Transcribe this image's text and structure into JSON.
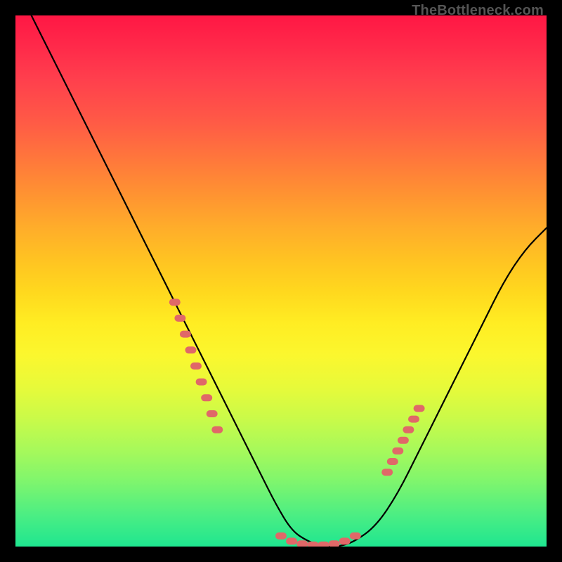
{
  "attribution": "TheBottleneck.com",
  "colors": {
    "frame": "#000000",
    "curve": "#000000",
    "marker": "#e06868",
    "gradient_top": "#ff1744",
    "gradient_bottom": "#1fe690"
  },
  "chart_data": {
    "type": "line",
    "title": "",
    "xlabel": "",
    "ylabel": "",
    "xlim": [
      0,
      100
    ],
    "ylim": [
      0,
      100
    ],
    "grid": false,
    "legend": false,
    "series": [
      {
        "name": "bottleneck-curve",
        "x": [
          3,
          6,
          10,
          14,
          18,
          22,
          26,
          30,
          34,
          38,
          42,
          46,
          49,
          52,
          55,
          58,
          61,
          64,
          68,
          72,
          76,
          80,
          84,
          88,
          92,
          96,
          100
        ],
        "y": [
          100,
          94,
          86,
          78,
          70,
          62,
          54,
          46,
          38,
          30,
          22,
          14,
          8,
          3,
          1,
          0,
          0,
          1,
          4,
          10,
          18,
          26,
          34,
          42,
          50,
          56,
          60
        ]
      }
    ],
    "markers": {
      "note": "highlighted points along the curve (salmon segments)",
      "points": [
        {
          "x": 30,
          "y": 46
        },
        {
          "x": 31,
          "y": 43
        },
        {
          "x": 32,
          "y": 40
        },
        {
          "x": 33,
          "y": 37
        },
        {
          "x": 34,
          "y": 34
        },
        {
          "x": 35,
          "y": 31
        },
        {
          "x": 36,
          "y": 28
        },
        {
          "x": 37,
          "y": 25
        },
        {
          "x": 38,
          "y": 22
        },
        {
          "x": 50,
          "y": 2
        },
        {
          "x": 52,
          "y": 1
        },
        {
          "x": 54,
          "y": 0.5
        },
        {
          "x": 56,
          "y": 0.3
        },
        {
          "x": 58,
          "y": 0.3
        },
        {
          "x": 60,
          "y": 0.5
        },
        {
          "x": 62,
          "y": 1
        },
        {
          "x": 64,
          "y": 2
        },
        {
          "x": 70,
          "y": 14
        },
        {
          "x": 71,
          "y": 16
        },
        {
          "x": 72,
          "y": 18
        },
        {
          "x": 73,
          "y": 20
        },
        {
          "x": 74,
          "y": 22
        },
        {
          "x": 75,
          "y": 24
        },
        {
          "x": 76,
          "y": 26
        }
      ]
    }
  }
}
